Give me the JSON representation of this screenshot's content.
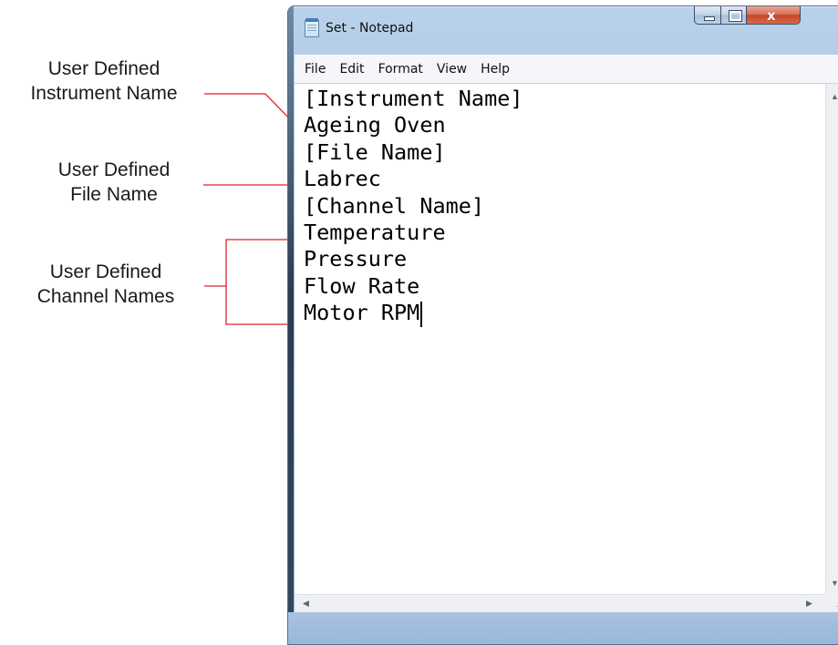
{
  "window": {
    "title": "Set - Notepad",
    "close_glyph": "x",
    "menu": [
      "File",
      "Edit",
      "Format",
      "View",
      "Help"
    ]
  },
  "document": {
    "lines": [
      "[Instrument Name]",
      "Ageing Oven",
      "[File Name]",
      "Labrec",
      "[Channel Name]",
      "Temperature",
      "Pressure",
      "Flow Rate",
      "Motor RPM"
    ]
  },
  "callouts": {
    "instrument": [
      "User Defined",
      "Instrument Name"
    ],
    "file": [
      "User Defined",
      "File Name"
    ],
    "channels": [
      "User Defined",
      "Channel Names"
    ]
  },
  "colors": {
    "arrow": "#e02127",
    "title_bar": "#b9d1ea",
    "close_button": "#c7432a"
  },
  "icons": {
    "scroll_up": "▲",
    "scroll_down": "▼",
    "scroll_left": "◀",
    "scroll_right": "▶",
    "size_grip": "⋰"
  }
}
